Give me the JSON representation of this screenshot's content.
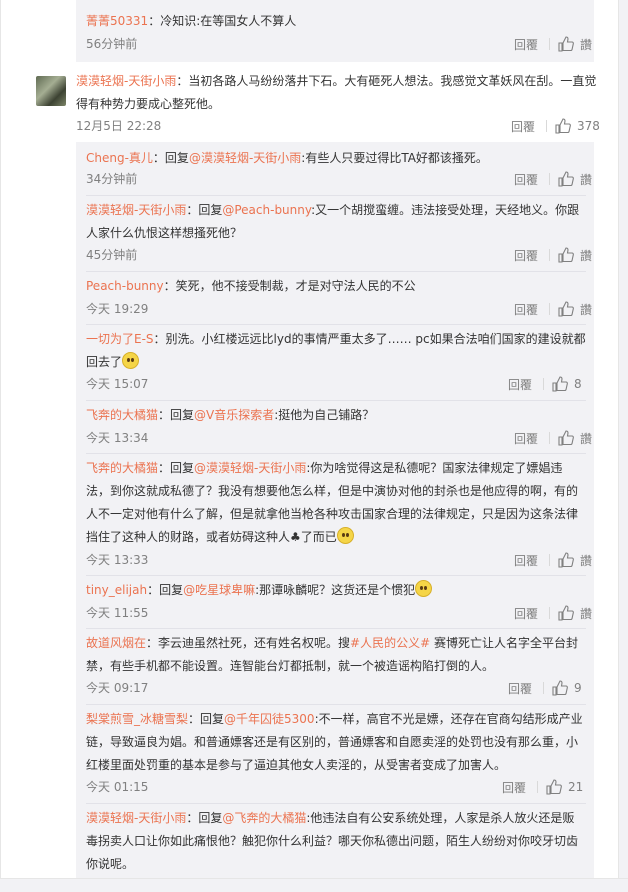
{
  "comments": {
    "top_reply": {
      "user": "菁菁50331",
      "text": "：冷知识:在等国女人不算人",
      "time": "56分钟前",
      "reply_label": "回覆",
      "like_label": "讚"
    },
    "main": {
      "user": "漠漠轻烟-天街小雨",
      "text_line1": "：当初各路人马纷纷落井下石。大有砸死人想法。我感觉文革妖风在刮。一直觉",
      "text_line2": "得有种势力要成心整死他。",
      "time": "12月5日 22:28",
      "reply_label": "回覆",
      "like_count": "378"
    },
    "replies": [
      {
        "user": "Cheng-真儿",
        "prefix": "：回复",
        "mention": "@漠漠轻烟-天街小雨",
        "text": ":有些人只要过得比TA好都该搔死。",
        "time": "34分钟前",
        "reply_label": "回覆",
        "like": "讚"
      },
      {
        "user": "漠漠轻烟-天街小雨",
        "prefix": "：回复",
        "mention": "@Peach-bunny",
        "text_line1": ":又一个胡搅蛮缠。违法接受处理，天经地义。你跟",
        "text_line2": "人家什么仇恨这样想搔死他？",
        "time": "45分钟前",
        "reply_label": "回覆",
        "like": "讚"
      },
      {
        "user": "Peach-bunny",
        "text": "：笑死，他不接受制裁，才是对守法人民的不公",
        "time": "今天 19:29",
        "reply_label": "回覆",
        "like": "讚"
      },
      {
        "user": "一切为了E-S",
        "text_line1": "：别洗。小红楼远远比lyd的事情严重太多了…… pc如果合法咱们国家的建设就都",
        "text_line2": "回去了",
        "time": "今天 15:07",
        "reply_label": "回覆",
        "like": "8"
      },
      {
        "user": "飞奔的大橘猫",
        "prefix": "：回复",
        "mention": "@V音乐探索者",
        "text": ":挺他为自己铺路？",
        "time": "今天 13:34",
        "reply_label": "回覆",
        "like": "讚"
      },
      {
        "user": "飞奔的大橘猫",
        "prefix": "：回复",
        "mention": "@漠漠轻烟-天街小雨",
        "text_line1": ":你为啥觉得这是私德呢？国家法律规定了嫖娼违",
        "text_line2": "法，到你这就成私德了？我没有想要他怎么样，但是中演协对他的封杀也是他应得的啊，有的",
        "text_line3": "人不一定对他有什么了解，但是就拿他当枪各种攻击国家合理的法律规定，只是因为这条法律",
        "text_line4": "挡住了这种人的财路，或者妨碍这种人♣了而已",
        "time": "今天 13:33",
        "reply_label": "回覆",
        "like": "讚"
      },
      {
        "user": "tiny_elijah",
        "prefix": "：回复",
        "mention": "@吃星球卑嘛",
        "text": ":那谭咏麟呢？这货还是个惯犯",
        "time": "今天 11:55",
        "reply_label": "回覆",
        "like": "讚"
      },
      {
        "user": "故道风烟在",
        "text_a": "：李云迪虽然社死，还有姓名权呢。搜",
        "topic": "#人民的公义#",
        "text_b": " 赛博死亡让人名字全平台封",
        "text_line2": "禁，有些手机都不能设置。连智能台灯都抵制，就一个被造谣构陷打倒的人。",
        "time": "今天 09:17",
        "reply_label": "回覆",
        "like": "9"
      },
      {
        "user": "梨棠煎雪_冰糖雪梨",
        "prefix": "：回复",
        "mention": "@千年囚徒5300",
        "text_line1": ":不一样，高官不光是嫖，还存在官商勾结形成产业",
        "text_line2": "链，导致逼良为娼。和普通嫖客还是有区别的，普通嫖客和自愿卖淫的处罚也没有那么重，小",
        "text_line3": "红楼里面处罚重的基本是参与了逼迫其他女人卖淫的，从受害者变成了加害人。",
        "time": "今天 01:15",
        "reply_label": "回覆",
        "like": "21"
      },
      {
        "user": "漠漠轻烟-天街小雨",
        "prefix": "：回复",
        "mention": "@飞奔的大橘猫",
        "text_line1": ":他违法自有公安系统处理，人家是杀人放火还是贩",
        "text_line2": "毒拐卖人口让你如此痛恨他？触犯你什么利益？哪天你私德出问题，陌生人纷纷对你咬牙切齿",
        "text_line3": "你说呢。"
      }
    ]
  }
}
